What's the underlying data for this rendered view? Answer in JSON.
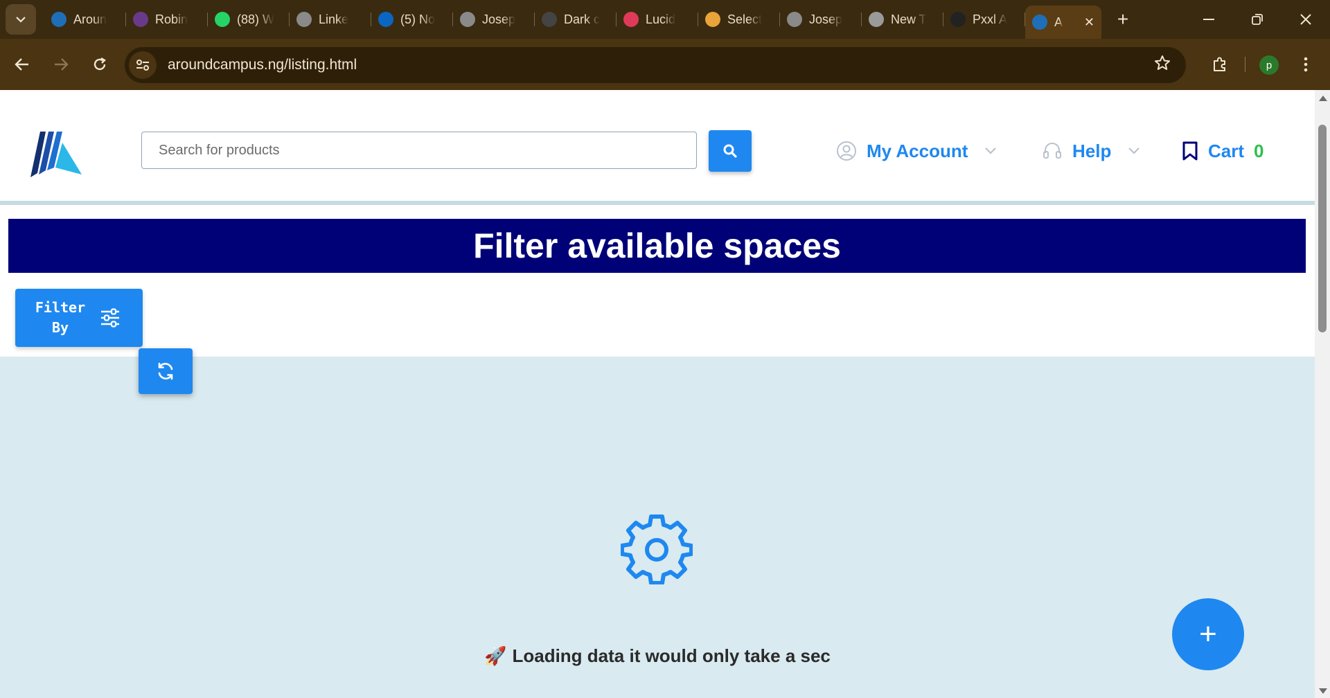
{
  "browser": {
    "tabs": [
      {
        "label": "Aroun",
        "favicon": "aroundcampus-logo-icon",
        "color": "#1e6fb8"
      },
      {
        "label": "Robin",
        "favicon": "avatar-icon",
        "color": "#6a3a8a"
      },
      {
        "label": "(88) W",
        "favicon": "whatsapp-icon",
        "color": "#25d366"
      },
      {
        "label": "Linke",
        "favicon": "globe-icon",
        "color": "#8a8a8a"
      },
      {
        "label": "(5) No",
        "favicon": "linkedin-icon",
        "color": "#0a66c2"
      },
      {
        "label": "Josep",
        "favicon": "globe-icon",
        "color": "#8a8a8a"
      },
      {
        "label": "Dark c",
        "favicon": "openai-icon",
        "color": "#444444"
      },
      {
        "label": "Lucid",
        "favicon": "lucid-icon",
        "color": "#e03a5a"
      },
      {
        "label": "Select",
        "favicon": "multicolor-logo-icon",
        "color": "#e8a33a"
      },
      {
        "label": "Josep",
        "favicon": "globe-icon",
        "color": "#8a8a8a"
      },
      {
        "label": "New T",
        "favicon": "chrome-icon",
        "color": "#9a9a9a"
      },
      {
        "label": "Pxxl A",
        "favicon": "pxxl-icon",
        "color": "#222222"
      },
      {
        "label": "A",
        "favicon": "aroundcampus-logo-icon",
        "color": "#1e6fb8",
        "active": true
      }
    ],
    "url": "aroundcampus.ng/listing.html",
    "profile_initial": "p"
  },
  "header": {
    "search_placeholder": "Search for products",
    "account_label": "My Account",
    "help_label": "Help",
    "cart_label": "Cart",
    "cart_count": "0"
  },
  "banner": {
    "title": "Filter available spaces"
  },
  "filter": {
    "line1": "Filter",
    "line2": "By"
  },
  "loading": {
    "text": "Loading data it would only take a sec"
  },
  "fab": {
    "label": "+"
  },
  "colors": {
    "accent": "#1e88f0",
    "banner_bg": "#010177",
    "content_bg": "#d9eaf0",
    "cart_count": "#2fbf4f"
  }
}
